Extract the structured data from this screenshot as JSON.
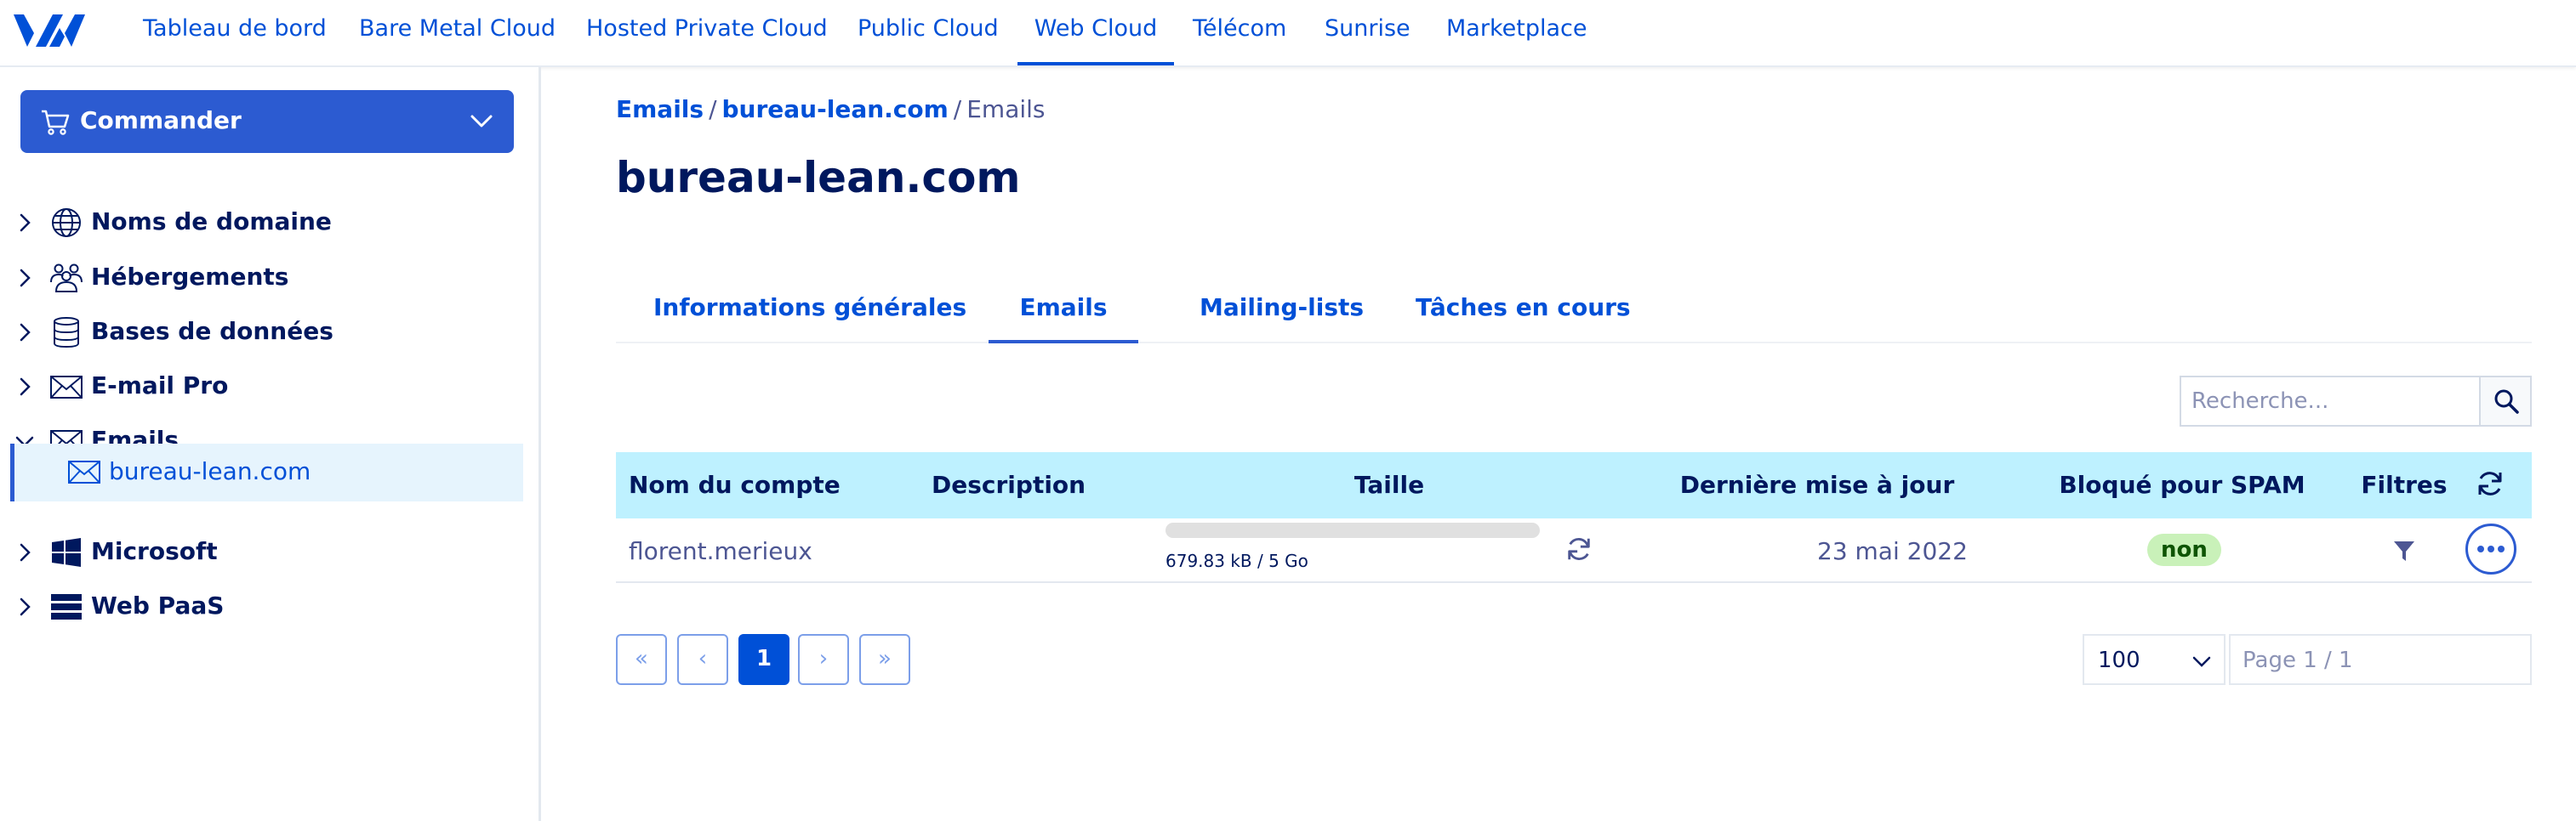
{
  "nav": {
    "items": [
      {
        "label": "Tableau de bord"
      },
      {
        "label": "Bare Metal Cloud"
      },
      {
        "label": "Hosted Private Cloud"
      },
      {
        "label": "Public Cloud"
      },
      {
        "label": "Web Cloud",
        "active": true
      },
      {
        "label": "Télécom"
      },
      {
        "label": "Sunrise"
      },
      {
        "label": "Marketplace"
      }
    ]
  },
  "sidebar": {
    "order_label": "Commander",
    "items": [
      {
        "label": "Noms de domaine",
        "icon": "globe-icon"
      },
      {
        "label": "Hébergements",
        "icon": "people-icon"
      },
      {
        "label": "Bases de données",
        "icon": "database-icon"
      },
      {
        "label": "E-mail Pro",
        "icon": "envelope-icon"
      },
      {
        "label": "Emails",
        "icon": "envelope-icon",
        "expanded": true
      },
      {
        "label": "Microsoft",
        "icon": "windows-icon"
      },
      {
        "label": "Web PaaS",
        "icon": "stack-icon"
      }
    ],
    "child": {
      "label": "bureau-lean.com",
      "icon": "envelope-icon"
    }
  },
  "breadcrumb": {
    "items": [
      "Emails",
      "bureau-lean.com"
    ],
    "current": "Emails",
    "separator": "/"
  },
  "page": {
    "title": "bureau-lean.com"
  },
  "tabs": [
    {
      "label": "Informations générales"
    },
    {
      "label": "Emails",
      "active": true
    },
    {
      "label": "Mailing-lists"
    },
    {
      "label": "Tâches en cours"
    }
  ],
  "search": {
    "placeholder": "Recherche..."
  },
  "table": {
    "columns": {
      "account": "Nom du compte",
      "description": "Description",
      "size": "Taille",
      "updated": "Dernière mise à jour",
      "spam": "Bloqué pour SPAM",
      "filters": "Filtres"
    },
    "rows": [
      {
        "account": "florent.merieux",
        "description": "",
        "usage_text": "679.83 kB / 5 Go",
        "usage_fraction": 0.0001,
        "updated": "23 mai 2022",
        "spam": "non"
      }
    ]
  },
  "pagination": {
    "first": "«",
    "prev": "‹",
    "current": "1",
    "next": "›",
    "last": "»",
    "per_page": "100",
    "page_info": "Page 1 / 1"
  },
  "colors": {
    "primary": "#0050d7",
    "navy": "#00185e",
    "header_bg": "#bef1ff",
    "button_bg": "#2c5bd1",
    "success_bg": "#c9f1b9"
  }
}
